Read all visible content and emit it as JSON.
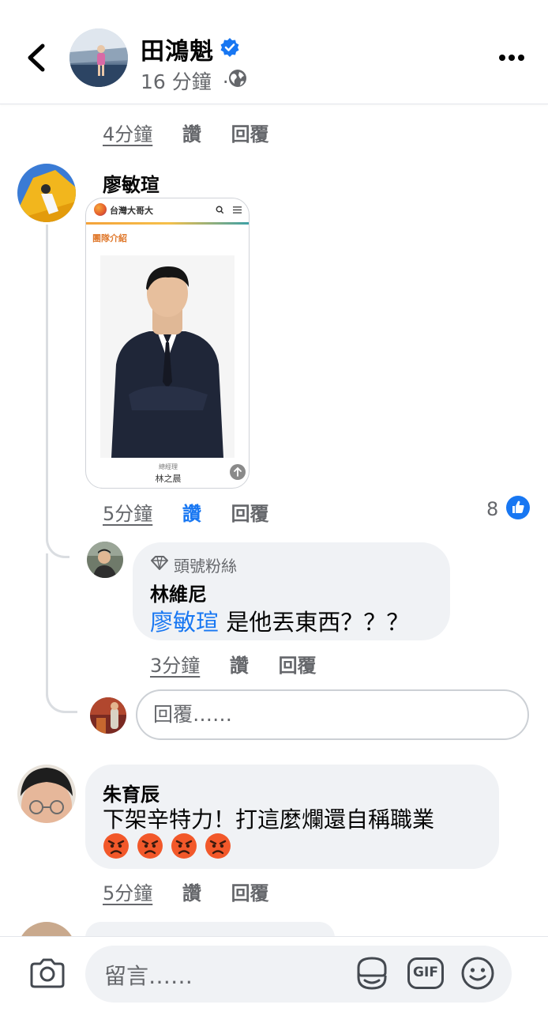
{
  "header": {
    "name": "田鴻魁",
    "time": "16 分鐘",
    "separator": "·",
    "icons": {
      "back": "chevron-left-icon",
      "verified": "verified-badge-icon",
      "privacy": "globe-icon",
      "more": "more-icon"
    },
    "colors": {
      "verified": "#1877f2"
    }
  },
  "prev_comment": {
    "time": "4分鐘",
    "like": "讚",
    "reply": "回覆"
  },
  "comment1": {
    "author": "廖敏瑄",
    "image": {
      "site_name": "台灣大哥大",
      "section_title": "團隊介紹",
      "person_role": "總經理",
      "person_name": "林之晨"
    },
    "time": "5分鐘",
    "like": "讚",
    "reply": "回覆",
    "reaction_count": "8",
    "reaction_icon": "thumbs-up-icon"
  },
  "reply1": {
    "badge_icon": "diamond-icon",
    "badge": "頭號粉絲",
    "author": "林維尼",
    "mention": "廖敏瑄",
    "text": " 是他丟東西？？？",
    "time": "3分鐘",
    "like": "讚",
    "reply": "回覆"
  },
  "reply_input": {
    "placeholder": "回覆……"
  },
  "comment2": {
    "author": "朱育辰",
    "text_line1": "下架辛特力！打這麼爛還自稱職業",
    "emojis": [
      "angry-face",
      "angry-face",
      "angry-face",
      "angry-face"
    ],
    "time": "5分鐘",
    "like": "讚",
    "reply": "回覆"
  },
  "bottom": {
    "placeholder": "留言……",
    "icons": [
      "camera-icon",
      "sticker-icon",
      "gif-icon",
      "smiley-icon"
    ],
    "gif_label": "GIF"
  },
  "colors": {
    "accent": "#1877f2",
    "muted": "#65676b",
    "bubble": "#f0f2f5"
  }
}
